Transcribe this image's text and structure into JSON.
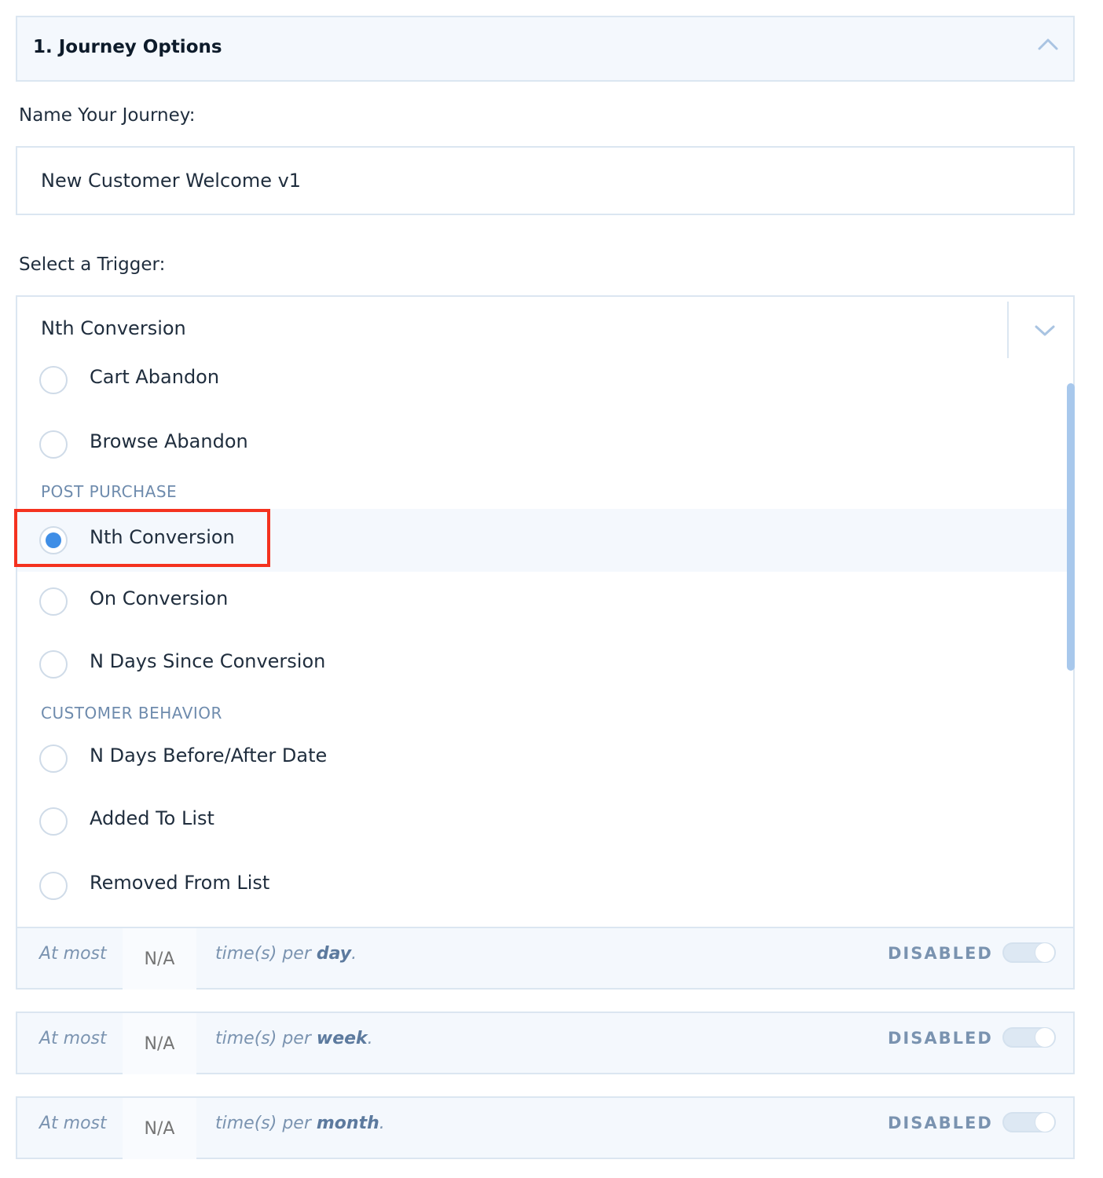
{
  "section": {
    "title": "1. Journey Options",
    "collapse_icon": "chevron-up-icon"
  },
  "name_field": {
    "label": "Name Your Journey:",
    "value": "New Customer Welcome v1"
  },
  "trigger": {
    "label": "Select a Trigger:",
    "selected_value": "Nth Conversion",
    "dropdown_icon": "chevron-down-icon",
    "groups": [
      {
        "name": "",
        "options": [
          "Cart Abandon",
          "Browse Abandon"
        ]
      },
      {
        "name": "POST PURCHASE",
        "options": [
          "Nth Conversion",
          "On Conversion",
          "N Days Since Conversion"
        ]
      },
      {
        "name": "CUSTOMER BEHAVIOR",
        "options": [
          "N Days Before/After Date",
          "Added To List",
          "Removed From List"
        ]
      }
    ],
    "selected_option": "Nth Conversion"
  },
  "limits": [
    {
      "prefix": "At most",
      "value": "N/A",
      "text_before": "time(s) per",
      "period": "day",
      "suffix": ".",
      "status": "DISABLED",
      "enabled": false
    },
    {
      "prefix": "At most",
      "value": "N/A",
      "text_before": "time(s) per",
      "period": "week",
      "suffix": ".",
      "status": "DISABLED",
      "enabled": false
    },
    {
      "prefix": "At most",
      "value": "N/A",
      "text_before": "time(s) per",
      "period": "month",
      "suffix": ".",
      "status": "DISABLED",
      "enabled": false
    }
  ],
  "colors": {
    "accent": "#3f8ee6",
    "highlight": "#f4321f",
    "muted": "#7a93b0",
    "border": "#dbe6f1",
    "panel": "#f4f8fd"
  }
}
